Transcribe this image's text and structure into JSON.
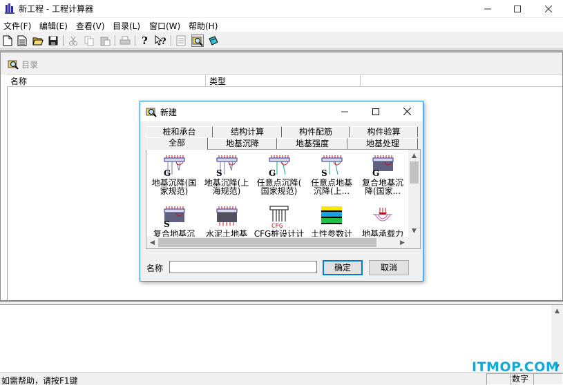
{
  "window": {
    "title": "新工程 - 工程计算器",
    "controls": [
      "minimize",
      "maximize",
      "close"
    ]
  },
  "menubar": {
    "items": [
      "文件(F)",
      "编辑(E)",
      "查看(V)",
      "目录(L)",
      "窗口(W)",
      "帮助(H)"
    ]
  },
  "toolbar": {
    "buttons": [
      "new-icon",
      "new-doc-icon",
      "open-icon",
      "save-icon",
      "cut-icon",
      "copy-icon",
      "paste-icon",
      "print-icon",
      "help-icon",
      "context-help-icon",
      "list-icon",
      "catalog-icon",
      "edit-icon"
    ]
  },
  "child_window": {
    "title": "目录",
    "columns": [
      "名称",
      "类型"
    ]
  },
  "dialog": {
    "title": "新建",
    "tabs_row1": [
      "桩和承台",
      "结构计算",
      "构件配筋",
      "构件验算"
    ],
    "tabs_row2": [
      "全部",
      "地基沉降",
      "地基强度",
      "地基处理"
    ],
    "active_tab": "全部",
    "items": [
      {
        "label": "地基沉降(国\n家规范)",
        "icon": "foundation-settlement-g-icon",
        "letter": "G"
      },
      {
        "label": "地基沉降(上\n海规范)",
        "icon": "foundation-settlement-s-icon",
        "letter": "S"
      },
      {
        "label": "任意点沉降(\n国家规范)",
        "icon": "point-settlement-g-icon",
        "letter": "G"
      },
      {
        "label": "任意点地基\n沉降(上...",
        "icon": "point-settlement-s-icon",
        "letter": "S"
      },
      {
        "label": "复合地基沉\n降(国家...",
        "icon": "composite-foundation-g-icon",
        "letter": "G"
      },
      {
        "label": "复合地基沉",
        "icon": "composite-foundation-s-icon",
        "letter": "S"
      },
      {
        "label": "水泥土地基",
        "icon": "cement-soil-foundation-icon",
        "letter": ""
      },
      {
        "label": "CFG桩设计计",
        "icon": "cfg-pile-icon",
        "letter": "CFG"
      },
      {
        "label": "土性参数计",
        "icon": "soil-parameter-icon",
        "letter": ""
      },
      {
        "label": "地基承载力",
        "icon": "bearing-capacity-icon",
        "letter": ""
      }
    ],
    "name_label": "名称",
    "name_value": "",
    "ok_label": "确定",
    "cancel_label": "取消"
  },
  "statusbar": {
    "text": "如需帮助，请按F1键",
    "pane_num": "数字"
  },
  "watermark": "ITMOP.COM",
  "colors": {
    "accent": "#1883d7",
    "watermark": "#12a9d6"
  }
}
